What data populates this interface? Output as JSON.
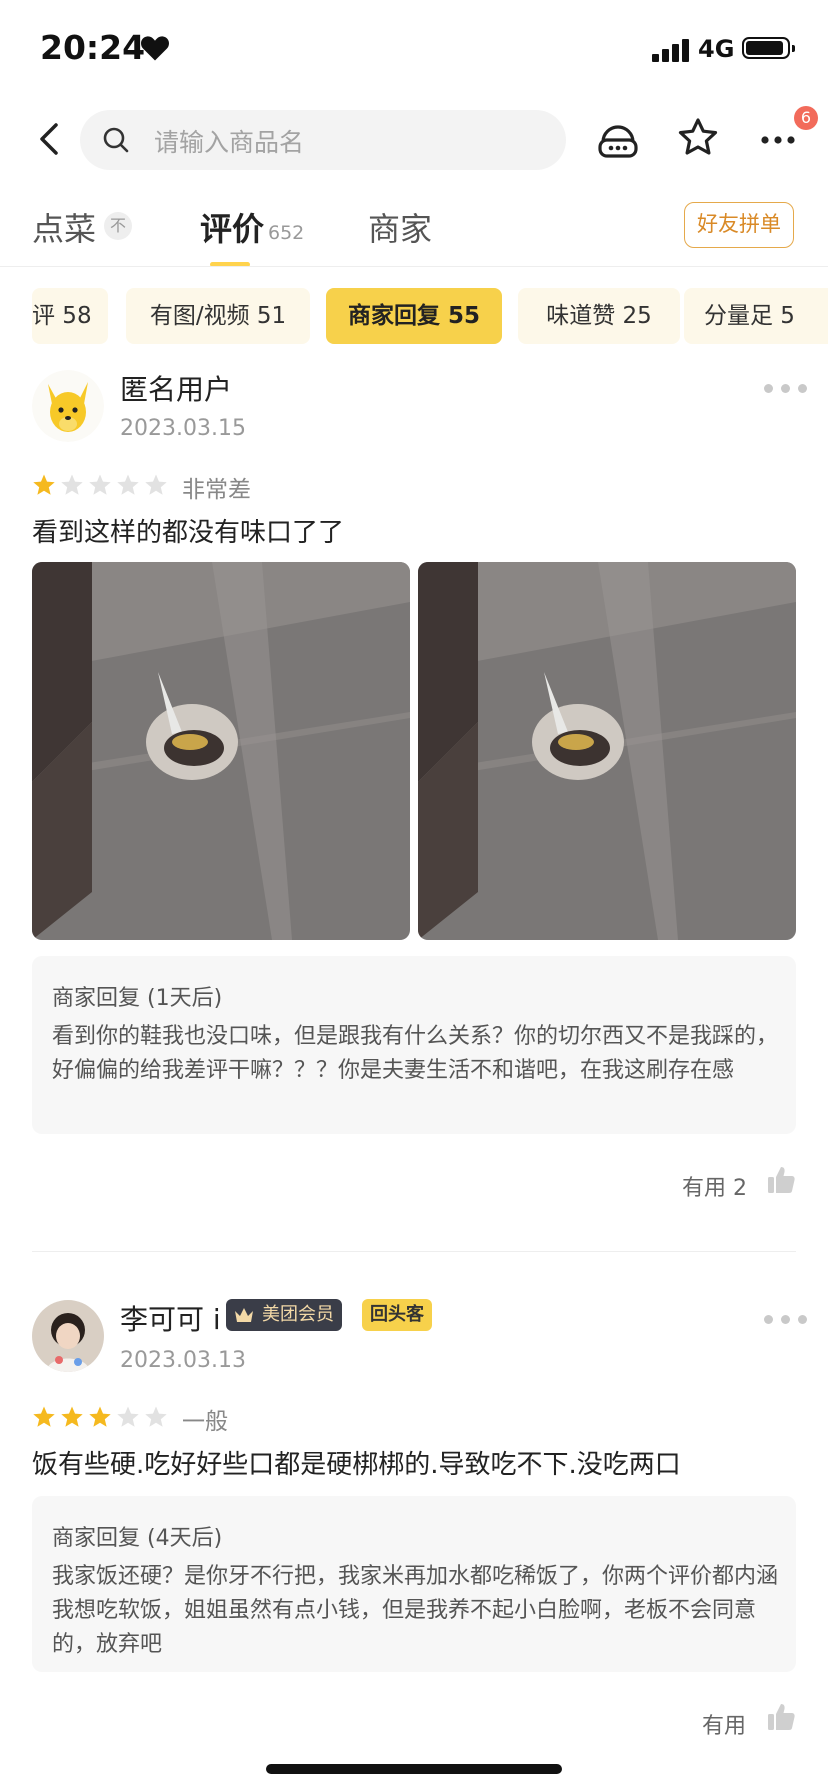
{
  "status_bar": {
    "time": "20:24",
    "network": "4G"
  },
  "nav": {
    "search_placeholder": "请输入商品名",
    "badge_count": "6"
  },
  "tabs": [
    {
      "label": "点菜",
      "pin": "不"
    },
    {
      "label": "评价",
      "count": "652"
    },
    {
      "label": "商家"
    }
  ],
  "group_order_label": "好友拼单",
  "filter_chips": [
    {
      "label": "评 58"
    },
    {
      "label": "有图/视频 51"
    },
    {
      "label": "商家回复 55"
    },
    {
      "label": "味道赞 25"
    },
    {
      "label": "分量足 5"
    }
  ],
  "colors": {
    "accent": "#f7d14b",
    "chip_bg": "#fdf8e9",
    "star": "#f5b91f",
    "badge": "#f26b5b"
  },
  "reviews": [
    {
      "user": "匿名用户",
      "date": "2023.03.15",
      "stars": 1,
      "rating_text": "非常差",
      "content": "看到这样的都没有味口了了",
      "reply_title": "商家回复 (1天后)",
      "reply_body": "看到你的鞋我也没口味，但是跟我有什么关系？你的切尔西又不是我踩的，好偏偏的给我差评干嘛？？？你是夫妻生活不和谐吧，在我这刷存在感",
      "useful": "有用 2"
    },
    {
      "user": "李可可 i",
      "member_badge": "美团会员",
      "repeat_badge": "回头客",
      "date": "2023.03.13",
      "stars": 3,
      "rating_text": "一般",
      "content": "饭有些硬.吃好好些口都是硬梆梆的.导致吃不下.没吃两口",
      "reply_title": "商家回复 (4天后)",
      "reply_body": "我家饭还硬？是你牙不行把，我家米再加水都吃稀饭了，你两个评价都内涵我想吃软饭，姐姐虽然有点小钱，但是我养不起小白脸啊，老板不会同意的，放弃吧",
      "useful": "有用"
    }
  ]
}
